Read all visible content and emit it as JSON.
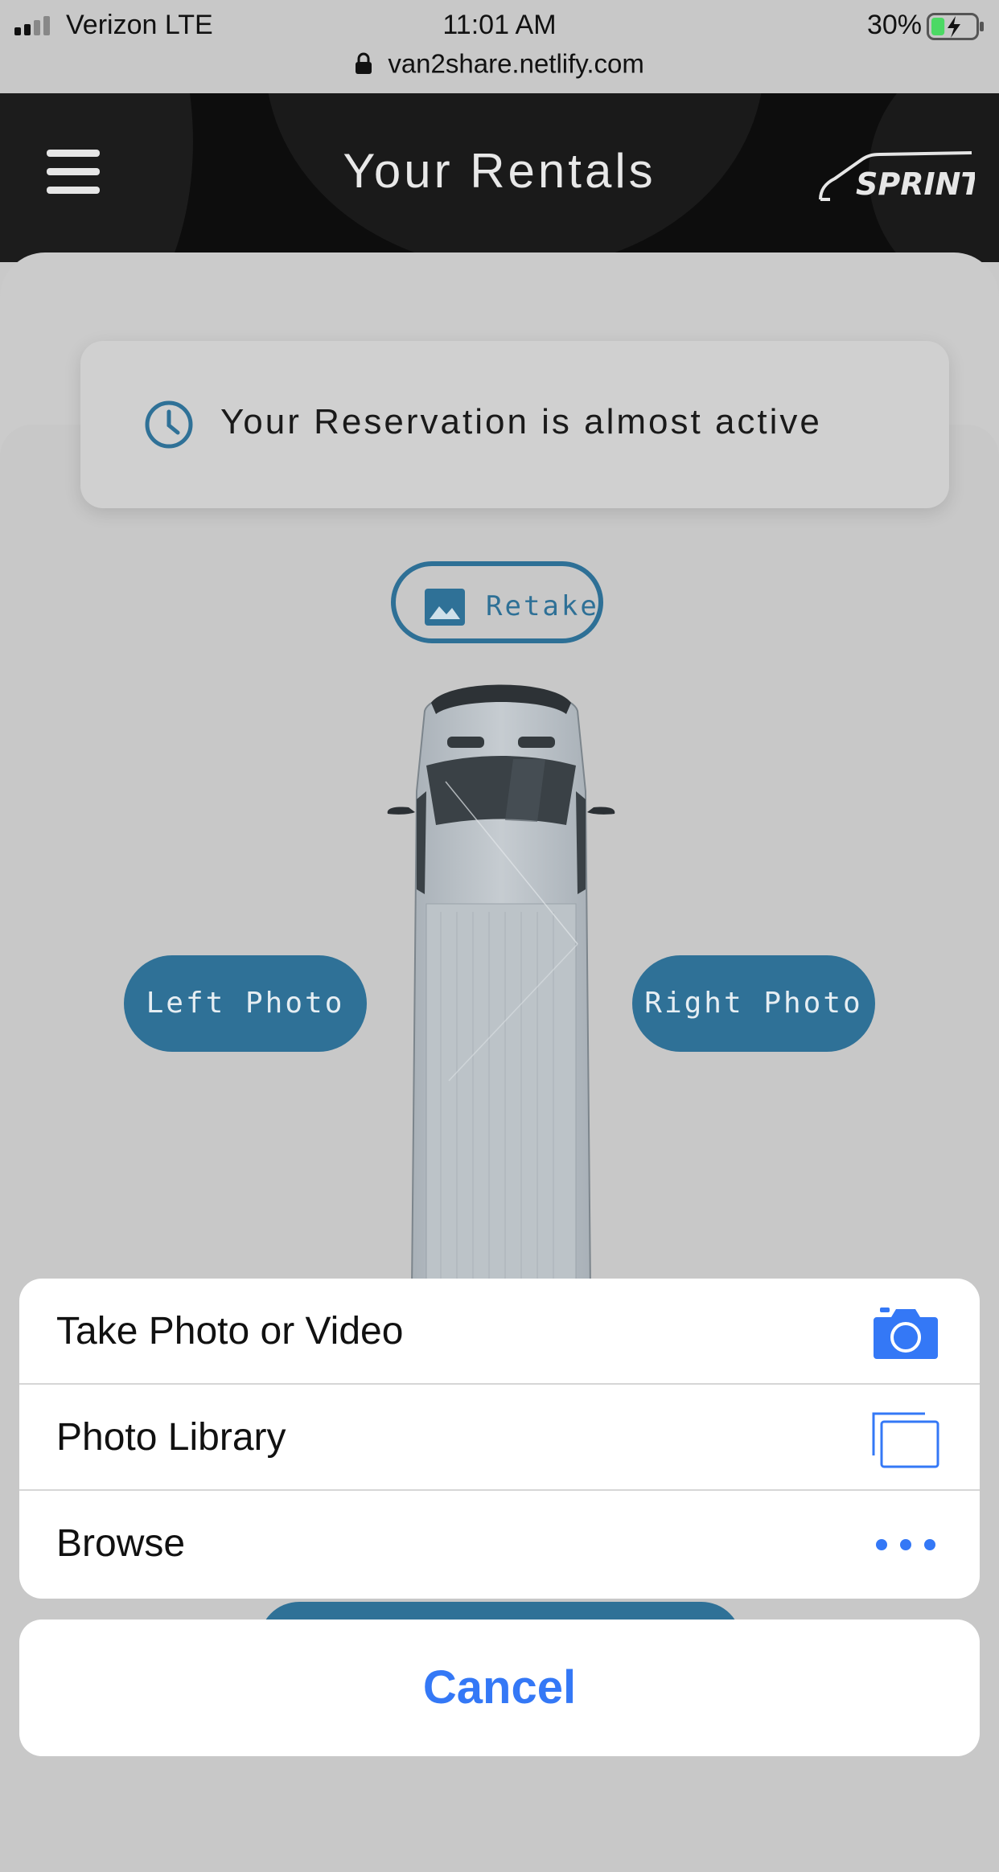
{
  "status_bar": {
    "carrier": "Verizon LTE",
    "time": "11:01 AM",
    "battery_percent": "30%",
    "battery_level": 0.3
  },
  "browser": {
    "url": "van2share.netlify.com"
  },
  "header": {
    "title": "Your Rentals",
    "brand_logo_text": "SPRINTER",
    "menu_icon": "hamburger-menu-icon"
  },
  "notice": {
    "icon": "clock-icon",
    "text": "Your Reservation is almost active"
  },
  "retake_button": {
    "icon": "image-icon",
    "label": "Retake"
  },
  "photo_buttons": {
    "left_label": "Left Photo",
    "right_label": "Right Photo"
  },
  "action_sheet": {
    "items": [
      {
        "label": "Take Photo or Video",
        "icon": "camera-icon"
      },
      {
        "label": "Photo Library",
        "icon": "photo-library-icon"
      },
      {
        "label": "Browse",
        "icon": "more-dots-icon"
      }
    ],
    "cancel_label": "Cancel"
  },
  "colors": {
    "accent": "#2f7197",
    "ios_blue": "#3478f6",
    "header_bg": "#0d0d0d"
  }
}
